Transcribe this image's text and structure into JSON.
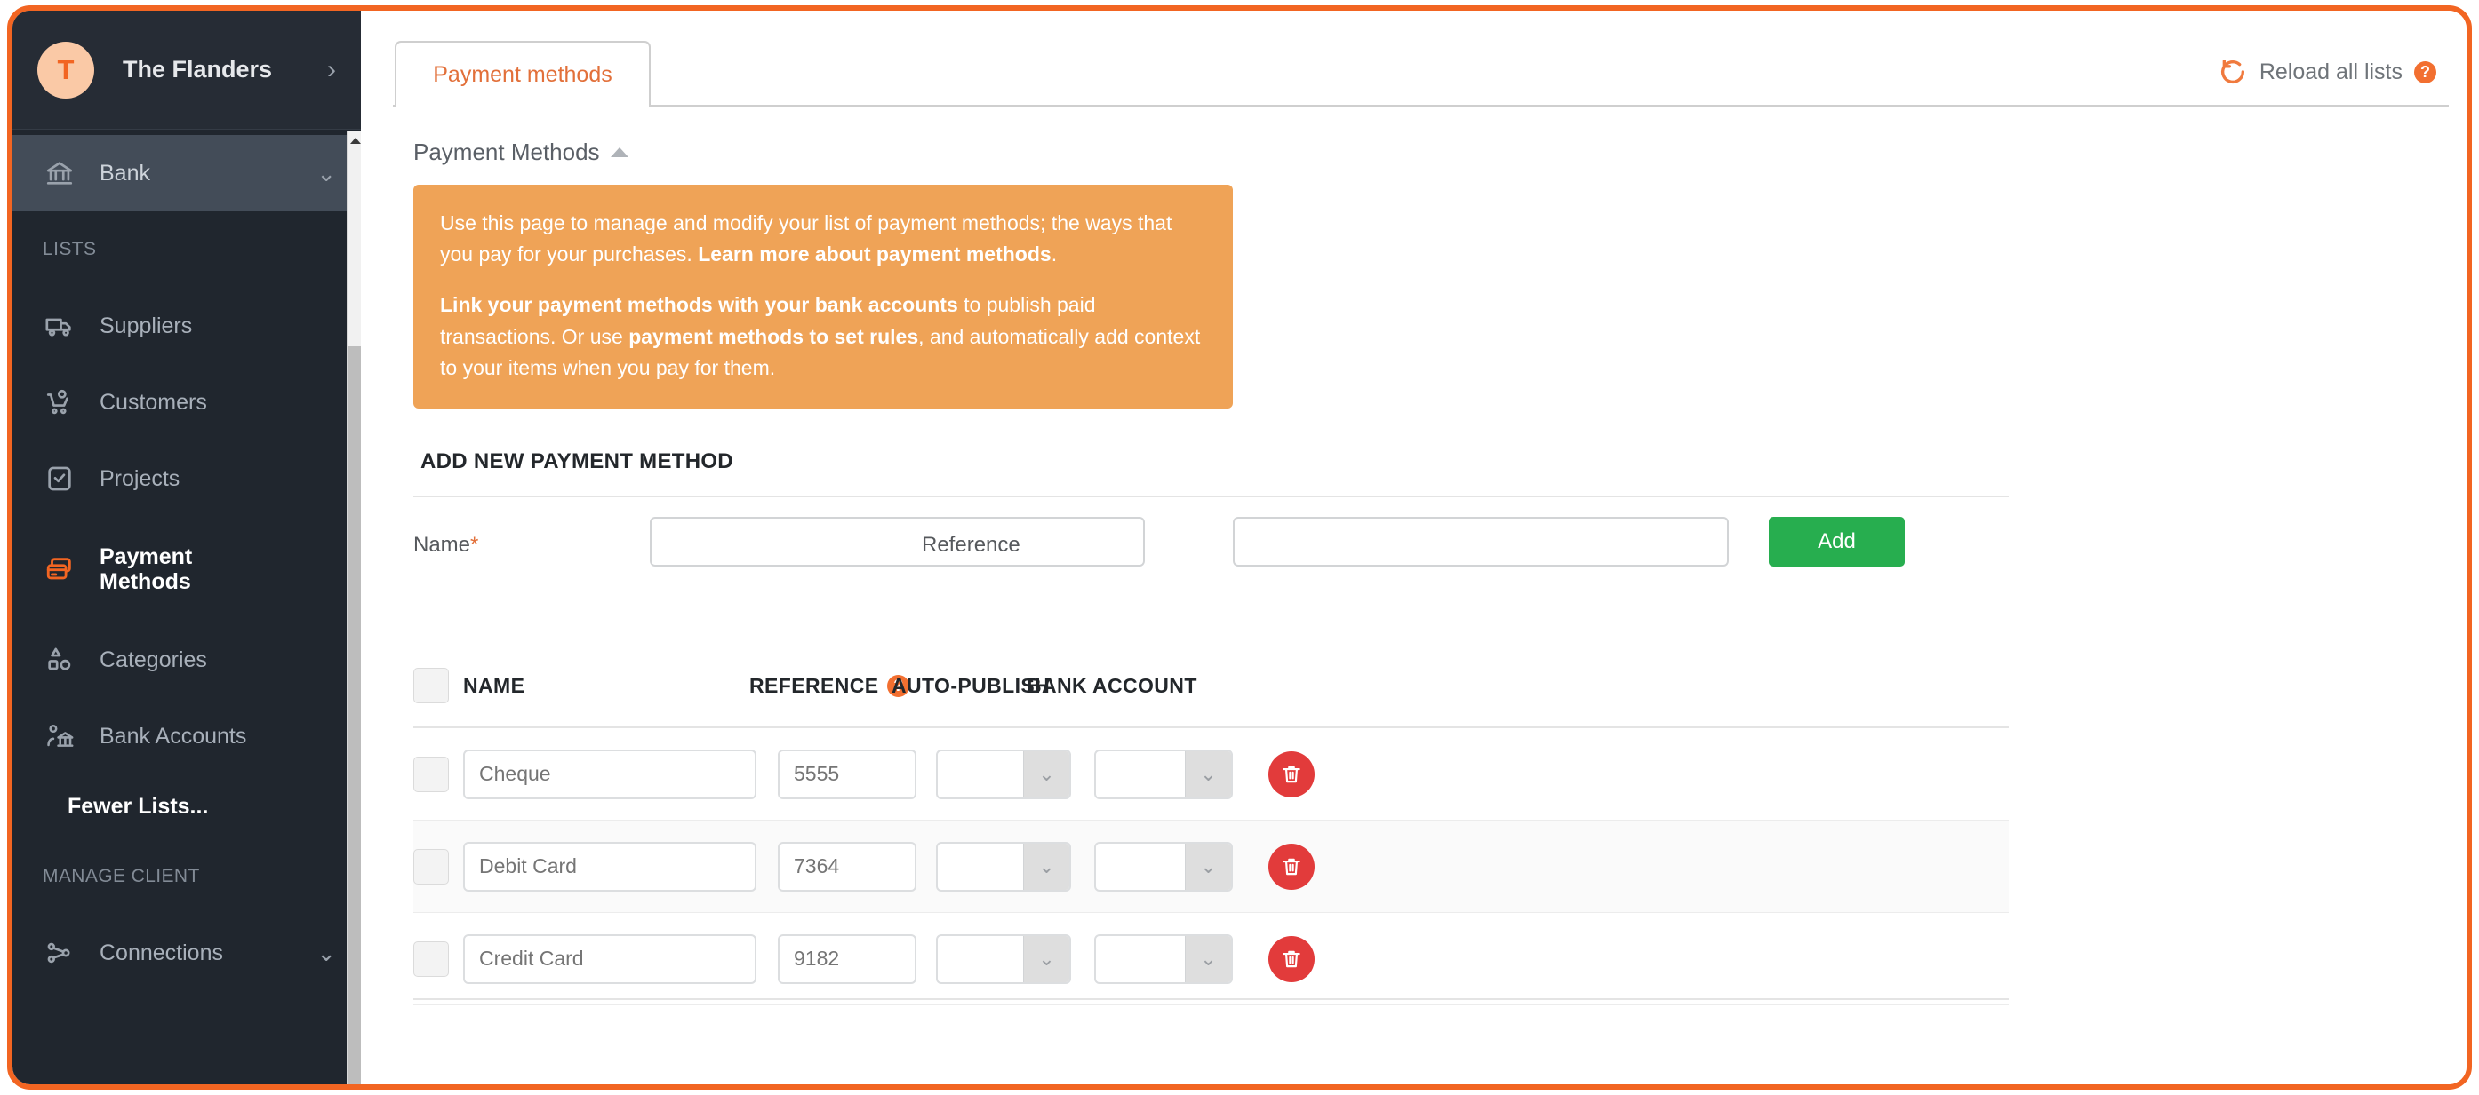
{
  "sidebar": {
    "workspace": {
      "avatar_initial": "T",
      "name": "The Flanders",
      "chevron": "›"
    },
    "partial_item_above": "",
    "items": [
      {
        "label": "Bank",
        "icon": "bank-icon",
        "state": "active",
        "chevron": "⌄"
      }
    ],
    "groups": [
      {
        "label": "LISTS",
        "items": [
          {
            "label": "Suppliers",
            "icon": "truck-icon"
          },
          {
            "label": "Customers",
            "icon": "customer-icon"
          },
          {
            "label": "Projects",
            "icon": "clipboard-check-icon"
          },
          {
            "label": "Payment Methods",
            "icon": "payment-card-icon",
            "current": true
          },
          {
            "label": "Categories",
            "icon": "shapes-icon"
          },
          {
            "label": "Bank Accounts",
            "icon": "bank-person-icon"
          }
        ],
        "link": "Fewer Lists..."
      },
      {
        "label": "MANAGE CLIENT",
        "items": [
          {
            "label": "Connections",
            "icon": "connections-icon",
            "chevron": "⌄"
          }
        ]
      }
    ]
  },
  "header": {
    "tabs": [
      {
        "label": "Payment methods",
        "active": true
      }
    ],
    "reload": {
      "label": "Reload all lists",
      "icon": "reload-icon",
      "help_badge": "?"
    }
  },
  "section": {
    "title": "Payment Methods",
    "collapse_icon": "caret-up-icon"
  },
  "banner": {
    "p1_a": "Use this page to manage and modify your list of payment methods; the ways that you pay for your purchases. ",
    "p1_b": "Learn more about payment methods",
    "p1_c": ".",
    "p2_a": "Link your payment methods with your bank accounts",
    "p2_b": " to publish paid transactions. Or use ",
    "p2_c": "payment methods to set rules",
    "p2_d": ", and automatically add context to your items when you pay for them.",
    "background_color": "#EFA357"
  },
  "add_form": {
    "heading": "ADD NEW PAYMENT METHOD",
    "name_label": "Name",
    "name_required_mark": "*",
    "name_value": "",
    "name_placeholder": "",
    "reference_label": "Reference",
    "reference_value": "",
    "reference_placeholder": "",
    "add_button_label": "Add",
    "add_button_color": "#27AE4F"
  },
  "table": {
    "columns": [
      {
        "key": "select",
        "label": ""
      },
      {
        "key": "name",
        "label": "NAME"
      },
      {
        "key": "reference",
        "label": "REFERENCE",
        "help_badge": "?"
      },
      {
        "key": "auto_publish",
        "label": "AUTO-PUBLISH"
      },
      {
        "key": "bank_account",
        "label": "BANK ACCOUNT"
      }
    ],
    "rows": [
      {
        "name": "Cheque",
        "reference": "5555",
        "auto_publish": "",
        "bank_account": "",
        "delete_icon": "trash-icon"
      },
      {
        "name": "Debit Card",
        "reference": "7364",
        "auto_publish": "",
        "bank_account": "",
        "delete_icon": "trash-icon"
      },
      {
        "name": "Credit Card",
        "reference": "9182",
        "auto_publish": "",
        "bank_account": "",
        "delete_icon": "trash-icon"
      }
    ],
    "dropdown_chevron": "⌄"
  },
  "theme": {
    "accent": "#F26522",
    "sidebar_bg": "#20262E",
    "active_nav_bg": "#434C58",
    "danger": "#E23B3B",
    "success": "#27AE4F",
    "banner": "#EFA357"
  }
}
